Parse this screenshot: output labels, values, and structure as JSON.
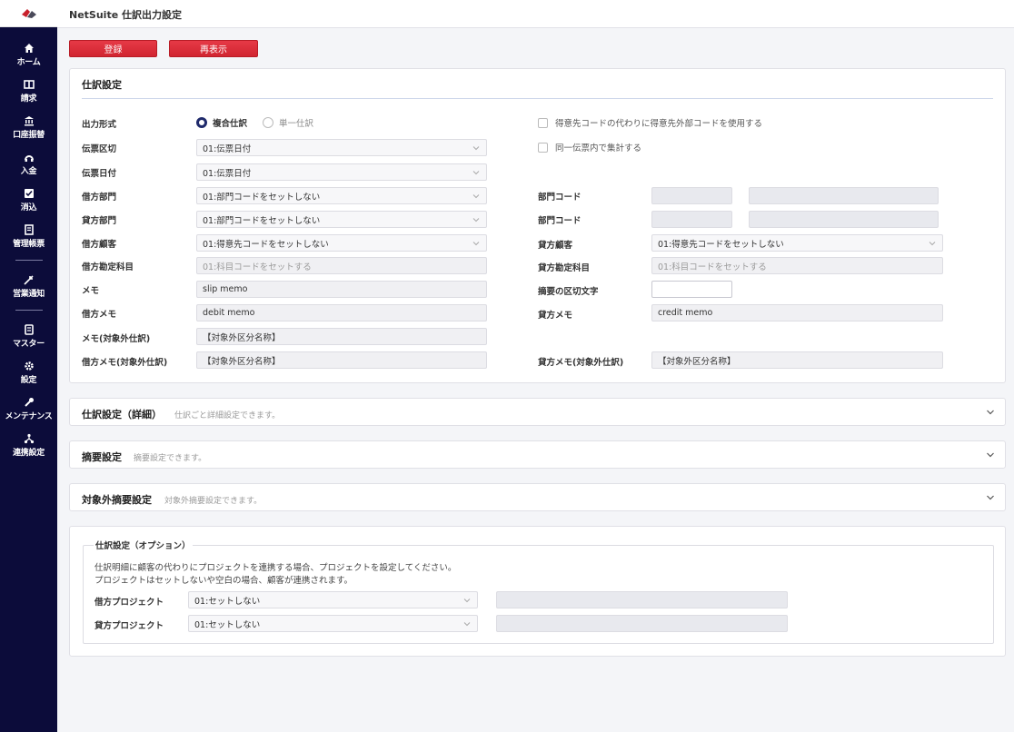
{
  "header": {
    "title": "NetSuite 仕訳出力設定"
  },
  "sidebar": {
    "items": [
      {
        "label": "ホーム",
        "icon": "home-icon"
      },
      {
        "label": "請求",
        "icon": "book-icon"
      },
      {
        "label": "口座振替",
        "icon": "bank-icon"
      },
      {
        "label": "入金",
        "icon": "deposit-icon"
      },
      {
        "label": "消込",
        "icon": "check-icon"
      },
      {
        "label": "管理帳票",
        "icon": "report-icon"
      },
      {
        "label": "営業通知",
        "icon": "notify-icon"
      },
      {
        "label": "マスター",
        "icon": "master-icon"
      },
      {
        "label": "設定",
        "icon": "gear-icon"
      },
      {
        "label": "メンテナンス",
        "icon": "wrench-icon"
      },
      {
        "label": "連携設定",
        "icon": "link-icon"
      }
    ]
  },
  "toolbar": {
    "register_label": "登録",
    "redisplay_label": "再表示"
  },
  "journal": {
    "title": "仕訳設定",
    "output_format_label": "出力形式",
    "radio_compound": "複合仕訳",
    "radio_single": "単一仕訳",
    "check_external_code": "得意先コードの代わりに得意先外部コードを使用する",
    "check_aggregate": "同一伝票内で集計する",
    "slip_split_label": "伝票区切",
    "slip_split_value": "01:伝票日付",
    "slip_date_label": "伝票日付",
    "slip_date_value": "01:伝票日付",
    "debit_dept_label": "借方部門",
    "debit_dept_value": "01:部門コードをセットしない",
    "credit_dept_label": "貸方部門",
    "credit_dept_value": "01:部門コードをセットしない",
    "dept_code_label_1": "部門コード",
    "dept_code_label_2": "部門コード",
    "debit_customer_label": "借方顧客",
    "debit_customer_value": "01:得意先コードをセットしない",
    "credit_customer_label": "貸方顧客",
    "credit_customer_value": "01:得意先コードをセットしない",
    "debit_account_label": "借方勘定科目",
    "debit_account_value": "01:科目コードをセットする",
    "credit_account_label": "貸方勘定科目",
    "credit_account_value": "01:科目コードをセットする",
    "memo_label": "メモ",
    "memo_value": "slip memo",
    "summary_sep_label": "摘要の区切文字",
    "summary_sep_value": "",
    "debit_memo_label": "借方メモ",
    "debit_memo_value": "debit memo",
    "credit_memo_label": "貸方メモ",
    "credit_memo_value": "credit memo",
    "memo_excluded_label": "メモ(対象外仕訳)",
    "memo_excluded_value": "【対象外区分名称】",
    "debit_memo_excluded_label": "借方メモ(対象外仕訳)",
    "debit_memo_excluded_value": "【対象外区分名称】",
    "credit_memo_excluded_label": "貸方メモ(対象外仕訳)",
    "credit_memo_excluded_value": "【対象外区分名称】"
  },
  "accordions": [
    {
      "title": "仕訳設定（詳細）",
      "sub": "仕訳ごと詳細設定できます。"
    },
    {
      "title": "摘要設定",
      "sub": "摘要設定できます。"
    },
    {
      "title": "対象外摘要設定",
      "sub": "対象外摘要設定できます。"
    }
  ],
  "options": {
    "legend": "仕訳設定（オプション）",
    "note1": "仕訳明細に顧客の代わりにプロジェクトを連携する場合、プロジェクトを設定してください。",
    "note2": "プロジェクトはセットしないや空白の場合、顧客が連携されます。",
    "debit_project_label": "借方プロジェクト",
    "debit_project_value": "01:セットしない",
    "credit_project_label": "貸方プロジェクト",
    "credit_project_value": "01:セットしない"
  },
  "colors": {
    "sidebar": "#0c0c3a",
    "accent_red": "#e0303c",
    "radio_on": "#1f2a6b"
  }
}
